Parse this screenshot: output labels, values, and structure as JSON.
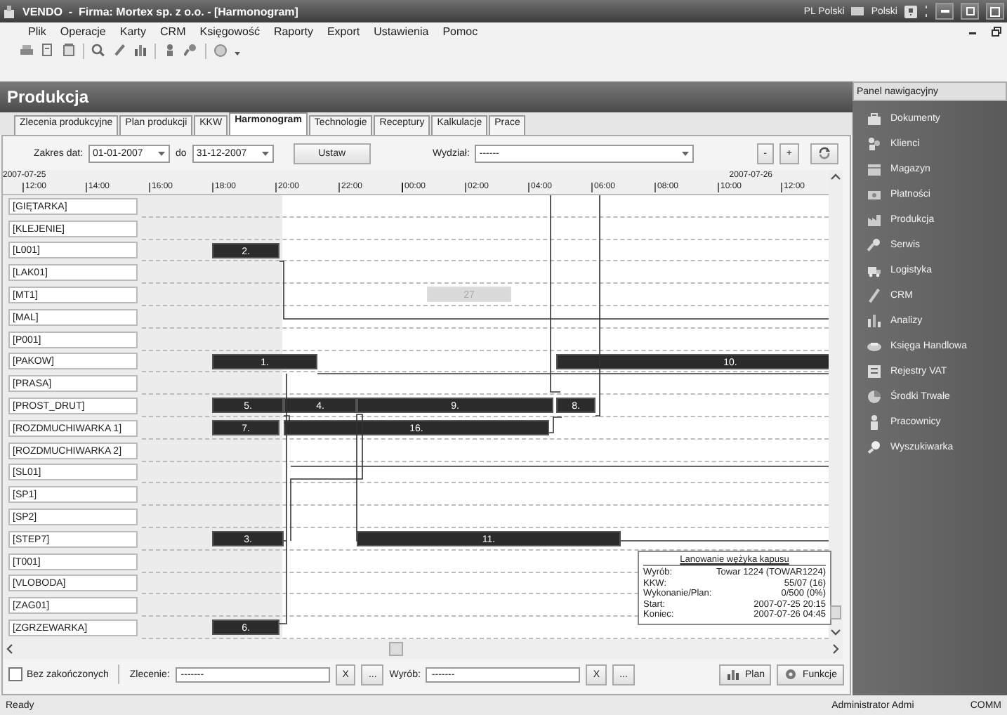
{
  "window": {
    "title": "VENDO  -  Firma: Mortex sp. z o.o. - [Harmonogram]",
    "language": "PL Polski",
    "keyboard": "Polski"
  },
  "menu": [
    "Plik",
    "Operacje",
    "Karty",
    "CRM",
    "Księgowość",
    "Raporty",
    "Export",
    "Ustawienia",
    "Pomoc"
  ],
  "module": {
    "title": "Produkcja"
  },
  "tabs": [
    {
      "label": "Zlecenia produkcyjne",
      "selected": false
    },
    {
      "label": "Plan produkcji",
      "selected": false
    },
    {
      "label": "KKW",
      "selected": false
    },
    {
      "label": "Harmonogram",
      "selected": true
    },
    {
      "label": "Technologie",
      "selected": false
    },
    {
      "label": "Receptury",
      "selected": false
    },
    {
      "label": "Kalkulacje",
      "selected": false
    },
    {
      "label": "Prace",
      "selected": false
    }
  ],
  "filters": {
    "date_range_label": "Zakres dat:",
    "date_from": "01-01-2007",
    "date_to_label": "do",
    "date_to": "31-12-2007",
    "apply_button": "Ustaw",
    "department_label": "Wydział:",
    "department": "------",
    "minus_button": "-",
    "plus_button": "+"
  },
  "timeline": {
    "dates": [
      "2007-07-25",
      "2007-07-26"
    ],
    "ticks": [
      "12:00",
      "14:00",
      "16:00",
      "18:00",
      "20:00",
      "22:00",
      "00:00",
      "02:00",
      "04:00",
      "06:00",
      "08:00",
      "10:00",
      "12:00"
    ]
  },
  "resources": [
    {
      "name": "[GIĘTARKA]"
    },
    {
      "name": "[KLEJENIE]"
    },
    {
      "name": "[L001]",
      "tasks": [
        {
          "label": "2.",
          "dimmed": false
        }
      ]
    },
    {
      "name": "[LAK01]"
    },
    {
      "name": "[MT1]",
      "tasks": [
        {
          "label": "27",
          "dimmed": true
        }
      ]
    },
    {
      "name": "[MAL]"
    },
    {
      "name": "[P001]"
    },
    {
      "name": "[PAKOW]",
      "tasks": [
        {
          "label": "1.",
          "dimmed": false
        },
        {
          "label": "10.",
          "dimmed": false
        }
      ]
    },
    {
      "name": "[PRASA]"
    },
    {
      "name": "[PROST_DRUT]",
      "tasks": [
        {
          "label": "5.",
          "dimmed": false
        },
        {
          "label": "4.",
          "dimmed": false
        },
        {
          "label": "9.",
          "dimmed": false
        },
        {
          "label": "8.",
          "dimmed": false
        }
      ]
    },
    {
      "name": "[ROZDMUCHIWARKA 1]",
      "tasks": [
        {
          "label": "7.",
          "dimmed": false
        },
        {
          "label": "16.",
          "dimmed": false
        }
      ]
    },
    {
      "name": "[ROZDMUCHIWARKA 2]"
    },
    {
      "name": "[SL01]"
    },
    {
      "name": "[SP1]"
    },
    {
      "name": "[SP2]"
    },
    {
      "name": "[STEP7]",
      "tasks": [
        {
          "label": "3.",
          "dimmed": false
        },
        {
          "label": "11.",
          "dimmed": false
        }
      ]
    },
    {
      "name": "[T001]"
    },
    {
      "name": "[VLOBODA]"
    },
    {
      "name": "[ZAG01]"
    },
    {
      "name": "[ZGRZEWARKA]",
      "tasks": [
        {
          "label": "6.",
          "dimmed": false
        }
      ]
    }
  ],
  "tooltip": {
    "title": "Lanowanie wężyka kapusu",
    "rows": [
      {
        "label": "Wyrób:",
        "value": "Towar 1224 (TOWAR1224)"
      },
      {
        "label": "KKW:",
        "value": "55/07 (16)"
      },
      {
        "label": "Wykonanie/Plan:",
        "value": "0/500 (0%)"
      },
      {
        "label": "Start:",
        "value": "2007-07-25 20:15"
      },
      {
        "label": "Koniec:",
        "value": "2007-07-26 04:45"
      }
    ]
  },
  "bottom": {
    "checkbox": {
      "label": "Bez zakończonych",
      "checked": false
    },
    "order_label": "Zlecenie:",
    "order": "-------",
    "order_clear": "X",
    "order_browse": "...",
    "product_label": "Wyrób:",
    "product": "-------",
    "product_clear": "X",
    "product_browse": "...",
    "plan_button": "Plan",
    "functions_button": "Funkcje"
  },
  "nav_panel": {
    "title": "Panel nawigacyjny",
    "items": [
      "Dokumenty",
      "Klienci",
      "Magazyn",
      "Płatności",
      "Produkcja",
      "Serwis",
      "Logistyka",
      "CRM",
      "Analizy",
      "Księga Handlowa",
      "Rejestry VAT",
      "Środki Trwałe",
      "Pracownicy",
      "Wyszukiwarka"
    ]
  },
  "status_bar": {
    "left": "Ready",
    "user": "Administrator Admi",
    "mode": "COMM"
  }
}
